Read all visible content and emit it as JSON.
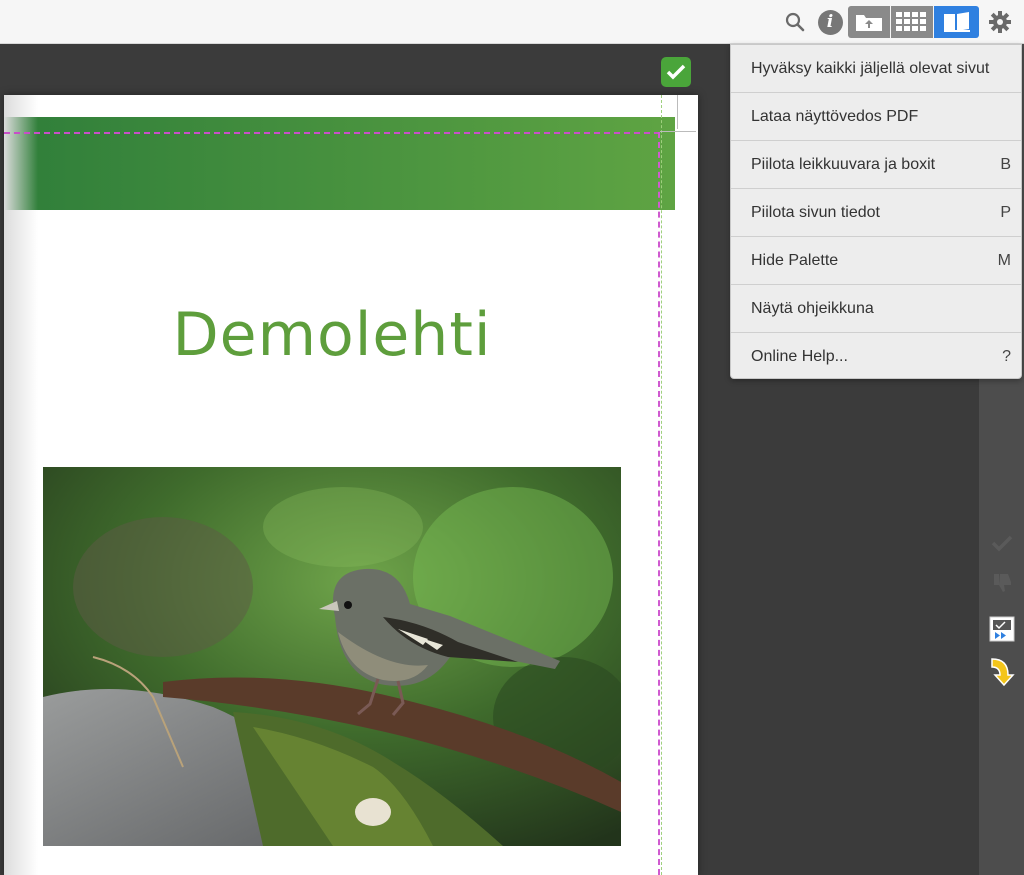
{
  "toolbar": {
    "icons": [
      "search-icon",
      "info-icon",
      "upload-view-icon",
      "grid-view-icon",
      "book-view-icon",
      "gear-icon"
    ],
    "active_view": "book-view"
  },
  "menu": {
    "items": [
      {
        "label": "Hyväksy kaikki jäljellä olevat sivut",
        "shortcut": ""
      },
      {
        "label": "Lataa näyttövedos PDF",
        "shortcut": ""
      },
      {
        "label": "Piilota leikkuuvara ja boxit",
        "shortcut": "B"
      },
      {
        "label": "Piilota sivun tiedot",
        "shortcut": "P"
      },
      {
        "label": "Hide Palette",
        "shortcut": "M"
      },
      {
        "label": "Näytä ohjeikkuna",
        "shortcut": ""
      },
      {
        "label": "Online Help...",
        "shortcut": "?"
      }
    ]
  },
  "page": {
    "title": "Demolehti",
    "banner_color_start": "#2f7e3a",
    "banner_color_end": "#5fa443",
    "title_color": "#5e9e3c",
    "approved": true
  },
  "side_tools": [
    "approve-check-icon",
    "reject-thumb-icon",
    "forward-page-icon",
    "next-arrow-icon"
  ],
  "colors": {
    "accent": "#2f80e0",
    "approve": "#4aa53a",
    "trim_marks": "#d05ad0"
  }
}
